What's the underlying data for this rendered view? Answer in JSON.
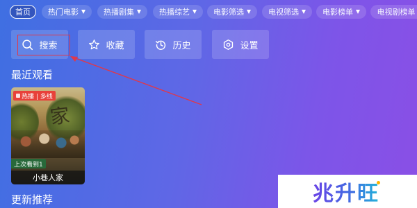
{
  "nav_tabs": [
    {
      "label": "首页",
      "dropdown": false,
      "active": true
    },
    {
      "label": "热门电影",
      "dropdown": true
    },
    {
      "label": "热播剧集",
      "dropdown": true
    },
    {
      "label": "热播综艺",
      "dropdown": true
    },
    {
      "label": "电影筛选",
      "dropdown": true
    },
    {
      "label": "电视筛选",
      "dropdown": true
    },
    {
      "label": "电影榜单",
      "dropdown": true
    },
    {
      "label": "电视剧榜单",
      "dropdown": true
    }
  ],
  "actions": [
    {
      "label": "搜索",
      "icon": "search-icon"
    },
    {
      "label": "收藏",
      "icon": "star-icon"
    },
    {
      "label": "历史",
      "icon": "history-icon"
    },
    {
      "label": "设置",
      "icon": "settings-icon"
    }
  ],
  "recent": {
    "heading": "最近观看",
    "items": [
      {
        "title": "小巷人家",
        "badge": "热播 | 多线",
        "progress": "上次看到1",
        "poster_art": "家"
      }
    ]
  },
  "recommend": {
    "heading": "更新推荐"
  },
  "watermark": {
    "text": "兆升旺"
  },
  "colors": {
    "bg_left": "#3f6fe2",
    "bg_right": "#8a4fe6",
    "highlight": "#e0384a",
    "badge": "#e8413a"
  }
}
